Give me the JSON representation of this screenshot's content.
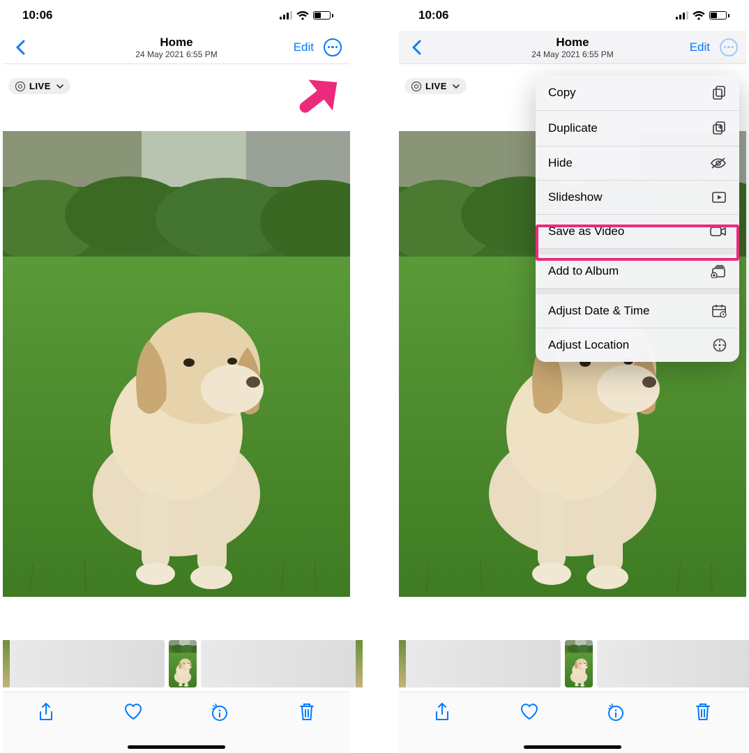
{
  "status": {
    "time": "10:06"
  },
  "nav": {
    "title": "Home",
    "subtitle": "24 May 2021  6:55 PM",
    "edit": "Edit"
  },
  "live": {
    "label": "LIVE"
  },
  "menu": {
    "copy": "Copy",
    "duplicate": "Duplicate",
    "hide": "Hide",
    "slideshow": "Slideshow",
    "saveVideo": "Save as Video",
    "addAlbum": "Add to Album",
    "adjDate": "Adjust Date & Time",
    "adjLoc": "Adjust Location"
  }
}
